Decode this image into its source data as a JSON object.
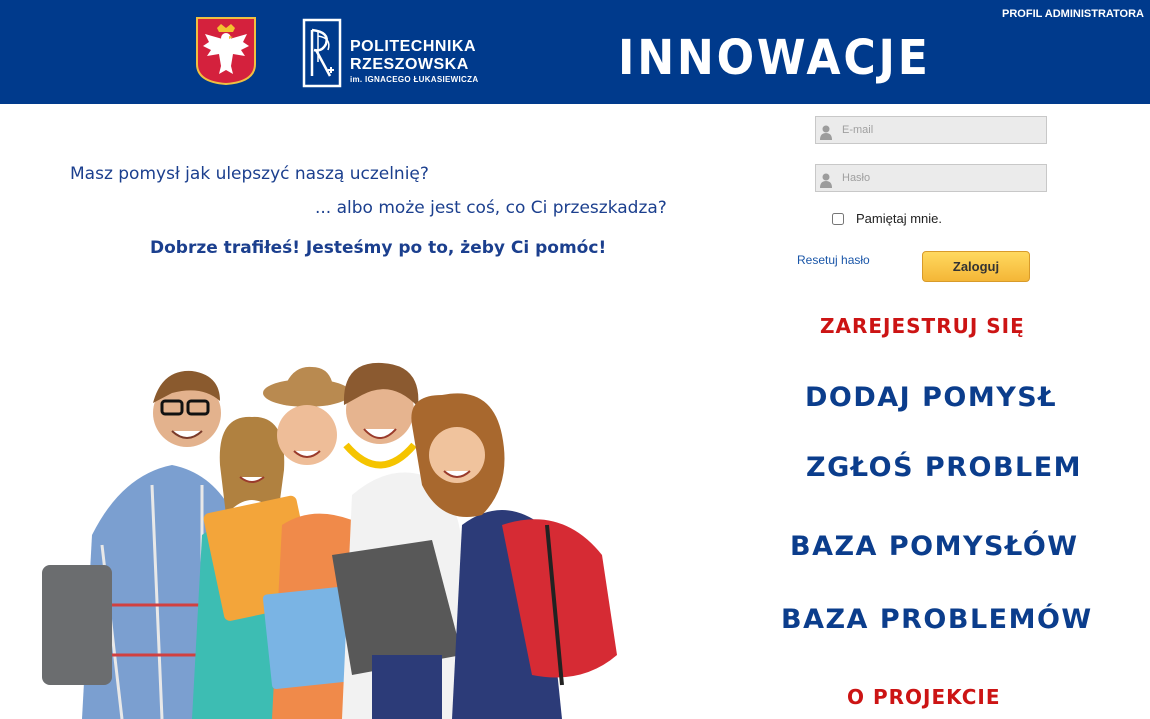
{
  "header": {
    "admin_link": "PROFIL ADMINISTRATORA",
    "logo_line1": "POLITECHNIKA",
    "logo_line2": "RZESZOWSKA",
    "logo_line3": "im. IGNACEGO ŁUKASIEWICZA",
    "title": "INNOWACJE",
    "emblem_icon": "polish-eagle-emblem-icon",
    "logo_icon": "politechnika-rzeszowska-logo-icon"
  },
  "intro": {
    "line1": "Masz pomysł jak ulepszyć naszą uczelnię?",
    "line2": "... albo może jest coś, co Ci przeszkadza?",
    "line3": "Dobrze trafiłeś! Jesteśmy po to, żeby Ci pomóc!"
  },
  "login": {
    "email_placeholder": "E-mail",
    "email_value": "",
    "password_placeholder": "Hasło",
    "password_value": "",
    "remember_label": "Pamiętaj mnie.",
    "remember_checked": false,
    "reset_link": "Resetuj hasło",
    "login_button": "Zaloguj",
    "field_icon": "user-icon"
  },
  "menu": {
    "register": "ZAREJESTRUJ SIĘ",
    "add_idea": "DODAJ POMYSŁ",
    "report_problem": "ZGŁOŚ PROBLEM",
    "ideas_base": "BAZA POMYSŁÓW",
    "problems_base": "BAZA PROBLEMÓW",
    "about": "O PROJEKCIE"
  },
  "colors": {
    "header_bg": "#003a8c",
    "menu_blue": "#0b3d8c",
    "menu_red": "#cc1414",
    "intro_text": "#1b3f8e",
    "login_button": "#f4b637"
  }
}
